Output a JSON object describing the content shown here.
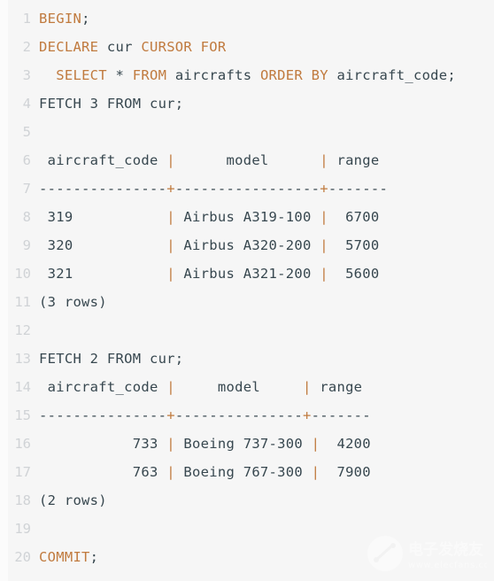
{
  "editor": {
    "background": "#f6f6f6",
    "keyword_color": "#c07a3e",
    "text_color": "#37474f",
    "line_number_color": "#d0d3d6",
    "language": "sql",
    "total_lines": 20
  },
  "lines": [
    {
      "number": "1",
      "tokens": [
        {
          "t": "BEGIN",
          "k": "kw"
        },
        {
          "t": ";",
          "k": "txt"
        }
      ]
    },
    {
      "number": "2",
      "tokens": [
        {
          "t": "DECLARE",
          "k": "kw"
        },
        {
          "t": " cur ",
          "k": "txt"
        },
        {
          "t": "CURSOR FOR",
          "k": "kw"
        }
      ]
    },
    {
      "number": "3",
      "tokens": [
        {
          "t": "  ",
          "k": "txt"
        },
        {
          "t": "SELECT",
          "k": "kw"
        },
        {
          "t": " * ",
          "k": "txt"
        },
        {
          "t": "FROM",
          "k": "kw"
        },
        {
          "t": " aircrafts ",
          "k": "txt"
        },
        {
          "t": "ORDER BY",
          "k": "kw"
        },
        {
          "t": " aircraft_code;",
          "k": "txt"
        }
      ]
    },
    {
      "number": "4",
      "tokens": [
        {
          "t": "FETCH 3 FROM cur;",
          "k": "txt"
        }
      ]
    },
    {
      "number": "5",
      "tokens": [
        {
          "t": "",
          "k": "txt"
        }
      ]
    },
    {
      "number": "6",
      "tokens": [
        {
          "t": " aircraft_code ",
          "k": "txt"
        },
        {
          "t": "|",
          "k": "pipe"
        },
        {
          "t": "      model      ",
          "k": "txt"
        },
        {
          "t": "|",
          "k": "pipe"
        },
        {
          "t": " range",
          "k": "txt"
        }
      ]
    },
    {
      "number": "7",
      "tokens": [
        {
          "t": "---------------",
          "k": "dash"
        },
        {
          "t": "+",
          "k": "plus"
        },
        {
          "t": "-----------------",
          "k": "dash"
        },
        {
          "t": "+",
          "k": "plus"
        },
        {
          "t": "-------",
          "k": "dash"
        }
      ]
    },
    {
      "number": "8",
      "tokens": [
        {
          "t": " 319           ",
          "k": "txt"
        },
        {
          "t": "|",
          "k": "pipe"
        },
        {
          "t": " Airbus A319-100 ",
          "k": "txt"
        },
        {
          "t": "|",
          "k": "pipe"
        },
        {
          "t": "  6700",
          "k": "txt"
        }
      ]
    },
    {
      "number": "9",
      "tokens": [
        {
          "t": " 320           ",
          "k": "txt"
        },
        {
          "t": "|",
          "k": "pipe"
        },
        {
          "t": " Airbus A320-200 ",
          "k": "txt"
        },
        {
          "t": "|",
          "k": "pipe"
        },
        {
          "t": "  5700",
          "k": "txt"
        }
      ]
    },
    {
      "number": "10",
      "tokens": [
        {
          "t": " 321           ",
          "k": "txt"
        },
        {
          "t": "|",
          "k": "pipe"
        },
        {
          "t": " Airbus A321-200 ",
          "k": "txt"
        },
        {
          "t": "|",
          "k": "pipe"
        },
        {
          "t": "  5600",
          "k": "txt"
        }
      ]
    },
    {
      "number": "11",
      "tokens": [
        {
          "t": "(3 rows)",
          "k": "txt"
        }
      ]
    },
    {
      "number": "12",
      "tokens": [
        {
          "t": "",
          "k": "txt"
        }
      ]
    },
    {
      "number": "13",
      "tokens": [
        {
          "t": "FETCH 2 FROM cur;",
          "k": "txt"
        }
      ]
    },
    {
      "number": "14",
      "tokens": [
        {
          "t": " aircraft_code ",
          "k": "txt"
        },
        {
          "t": "|",
          "k": "pipe"
        },
        {
          "t": "     model     ",
          "k": "txt"
        },
        {
          "t": "|",
          "k": "pipe"
        },
        {
          "t": " range",
          "k": "txt"
        }
      ]
    },
    {
      "number": "15",
      "tokens": [
        {
          "t": "---------------",
          "k": "dash"
        },
        {
          "t": "+",
          "k": "plus"
        },
        {
          "t": "---------------",
          "k": "dash"
        },
        {
          "t": "+",
          "k": "plus"
        },
        {
          "t": "-------",
          "k": "dash"
        }
      ]
    },
    {
      "number": "16",
      "tokens": [
        {
          "t": "           733 ",
          "k": "txt"
        },
        {
          "t": "|",
          "k": "pipe"
        },
        {
          "t": " Boeing 737-300 ",
          "k": "txt"
        },
        {
          "t": "|",
          "k": "pipe"
        },
        {
          "t": "  4200",
          "k": "txt"
        }
      ]
    },
    {
      "number": "17",
      "tokens": [
        {
          "t": "           763 ",
          "k": "txt"
        },
        {
          "t": "|",
          "k": "pipe"
        },
        {
          "t": " Boeing 767-300 ",
          "k": "txt"
        },
        {
          "t": "|",
          "k": "pipe"
        },
        {
          "t": "  7900",
          "k": "txt"
        }
      ]
    },
    {
      "number": "18",
      "tokens": [
        {
          "t": "(2 rows)",
          "k": "txt"
        }
      ]
    },
    {
      "number": "19",
      "tokens": [
        {
          "t": "",
          "k": "txt"
        }
      ]
    },
    {
      "number": "20",
      "tokens": [
        {
          "t": "COMMIT",
          "k": "kw"
        },
        {
          "t": ";",
          "k": "txt"
        }
      ]
    }
  ],
  "result_tables": [
    {
      "statement": "FETCH 3 FROM cur;",
      "columns": [
        "aircraft_code",
        "model",
        "range"
      ],
      "rows": [
        [
          "319",
          "Airbus A319-100",
          "6700"
        ],
        [
          "320",
          "Airbus A320-200",
          "5700"
        ],
        [
          "321",
          "Airbus A321-200",
          "5600"
        ]
      ],
      "row_count_label": "(3 rows)"
    },
    {
      "statement": "FETCH 2 FROM cur;",
      "columns": [
        "aircraft_code",
        "model",
        "range"
      ],
      "rows": [
        [
          "733",
          "Boeing 737-300",
          "4200"
        ],
        [
          "763",
          "Boeing 767-300",
          "7900"
        ]
      ],
      "row_count_label": "(2 rows)"
    }
  ],
  "watermark": {
    "chinese_text": "电子发烧友",
    "url_text": "www.elecfans.com"
  }
}
